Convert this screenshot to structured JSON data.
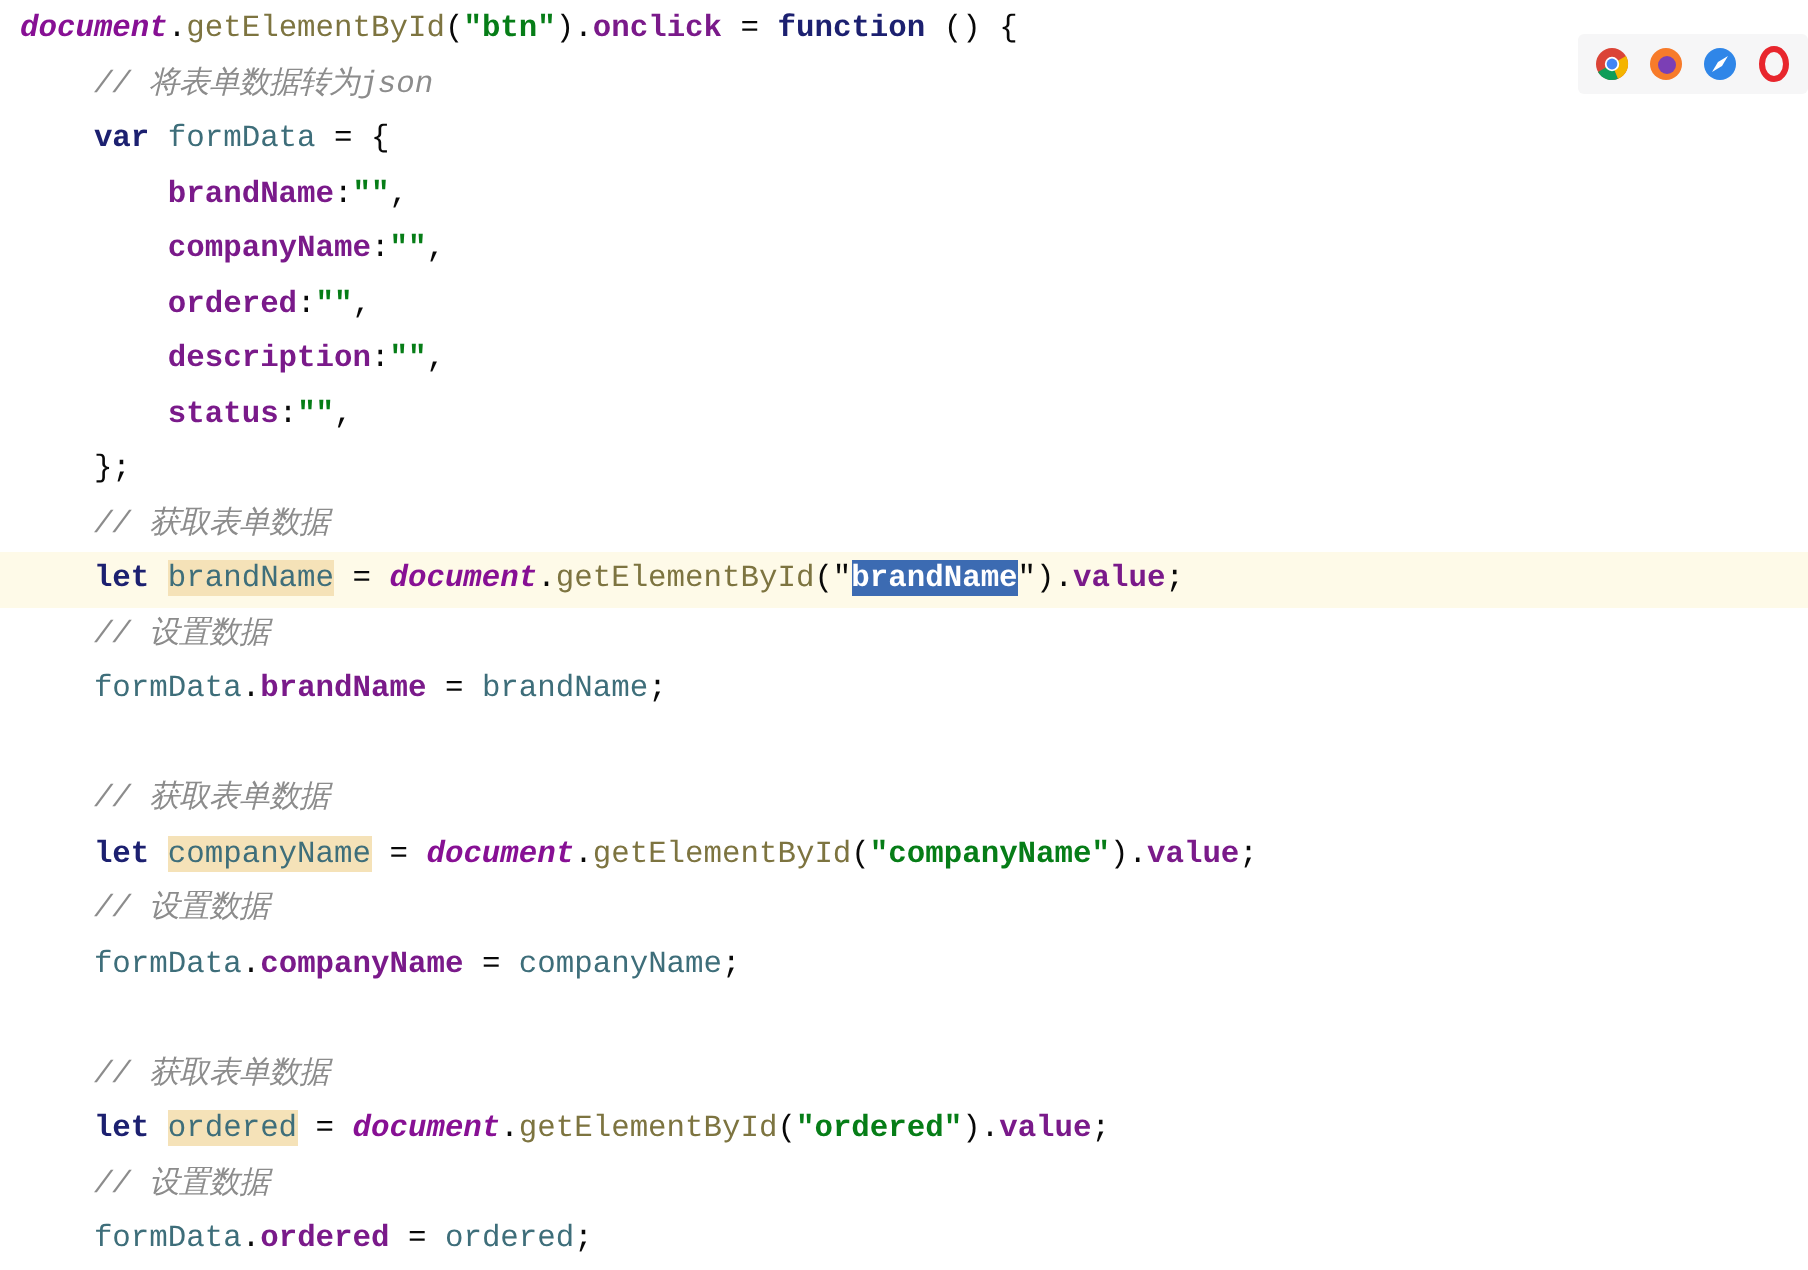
{
  "editor": {
    "lines": [
      {
        "current": false,
        "tokens": [
          {
            "kind": "global",
            "text": "document"
          },
          {
            "kind": "punct",
            "text": "."
          },
          {
            "kind": "method",
            "text": "getElementById"
          },
          {
            "kind": "punct",
            "text": "("
          },
          {
            "kind": "string",
            "text": "\"btn\""
          },
          {
            "kind": "punct",
            "text": ")."
          },
          {
            "kind": "field",
            "text": "onclick"
          },
          {
            "kind": "punct",
            "text": " = "
          },
          {
            "kind": "keyword",
            "text": "function"
          },
          {
            "kind": "punct",
            "text": " () {"
          }
        ]
      },
      {
        "current": false,
        "tokens": [
          {
            "kind": "comment",
            "text": "    // 将表单数据转为json"
          }
        ]
      },
      {
        "current": false,
        "tokens": [
          {
            "kind": "keyword",
            "text": "    var "
          },
          {
            "kind": "var",
            "text": "formData"
          },
          {
            "kind": "punct",
            "text": " = {"
          }
        ]
      },
      {
        "current": false,
        "tokens": [
          {
            "kind": "field",
            "text": "        brandName"
          },
          {
            "kind": "punct",
            "text": ":"
          },
          {
            "kind": "string",
            "text": "\"\""
          },
          {
            "kind": "punct",
            "text": ","
          }
        ]
      },
      {
        "current": false,
        "tokens": [
          {
            "kind": "field",
            "text": "        companyName"
          },
          {
            "kind": "punct",
            "text": ":"
          },
          {
            "kind": "string",
            "text": "\"\""
          },
          {
            "kind": "punct",
            "text": ","
          }
        ]
      },
      {
        "current": false,
        "tokens": [
          {
            "kind": "field",
            "text": "        ordered"
          },
          {
            "kind": "punct",
            "text": ":"
          },
          {
            "kind": "string",
            "text": "\"\""
          },
          {
            "kind": "punct",
            "text": ","
          }
        ]
      },
      {
        "current": false,
        "tokens": [
          {
            "kind": "field",
            "text": "        description"
          },
          {
            "kind": "punct",
            "text": ":"
          },
          {
            "kind": "string",
            "text": "\"\""
          },
          {
            "kind": "punct",
            "text": ","
          }
        ]
      },
      {
        "current": false,
        "tokens": [
          {
            "kind": "field",
            "text": "        status"
          },
          {
            "kind": "punct",
            "text": ":"
          },
          {
            "kind": "string",
            "text": "\"\""
          },
          {
            "kind": "punct",
            "text": ","
          }
        ]
      },
      {
        "current": false,
        "tokens": [
          {
            "kind": "punct",
            "text": "    };"
          }
        ]
      },
      {
        "current": false,
        "tokens": [
          {
            "kind": "comment",
            "text": "    // 获取表单数据"
          }
        ]
      },
      {
        "current": true,
        "tokens": [
          {
            "kind": "keyword",
            "text": "    let "
          },
          {
            "kind": "var",
            "text": "brandName",
            "highlighted": true
          },
          {
            "kind": "punct",
            "text": " = "
          },
          {
            "kind": "global",
            "text": "document"
          },
          {
            "kind": "punct",
            "text": "."
          },
          {
            "kind": "method",
            "text": "getElementById"
          },
          {
            "kind": "punct",
            "text": "(\""
          },
          {
            "kind": "string",
            "text": "brandName",
            "selected": true
          },
          {
            "kind": "punct",
            "text": "\")."
          },
          {
            "kind": "field",
            "text": "value"
          },
          {
            "kind": "punct",
            "text": ";"
          }
        ]
      },
      {
        "current": false,
        "tokens": [
          {
            "kind": "comment",
            "text": "    // 设置数据"
          }
        ]
      },
      {
        "current": false,
        "tokens": [
          {
            "kind": "var",
            "text": "    formData"
          },
          {
            "kind": "punct",
            "text": "."
          },
          {
            "kind": "field",
            "text": "brandName"
          },
          {
            "kind": "punct",
            "text": " = "
          },
          {
            "kind": "var",
            "text": "brandName"
          },
          {
            "kind": "punct",
            "text": ";"
          }
        ]
      },
      {
        "current": false
      },
      {
        "current": false,
        "tokens": [
          {
            "kind": "comment",
            "text": "    // 获取表单数据"
          }
        ]
      },
      {
        "current": false,
        "tokens": [
          {
            "kind": "keyword",
            "text": "    let "
          },
          {
            "kind": "var",
            "text": "companyName",
            "highlighted": true
          },
          {
            "kind": "punct",
            "text": " = "
          },
          {
            "kind": "global",
            "text": "document"
          },
          {
            "kind": "punct",
            "text": "."
          },
          {
            "kind": "method",
            "text": "getElementById"
          },
          {
            "kind": "punct",
            "text": "("
          },
          {
            "kind": "string",
            "text": "\"companyName\""
          },
          {
            "kind": "punct",
            "text": ")."
          },
          {
            "kind": "field",
            "text": "value"
          },
          {
            "kind": "punct",
            "text": ";"
          }
        ]
      },
      {
        "current": false,
        "tokens": [
          {
            "kind": "comment",
            "text": "    // 设置数据"
          }
        ]
      },
      {
        "current": false,
        "tokens": [
          {
            "kind": "var",
            "text": "    formData"
          },
          {
            "kind": "punct",
            "text": "."
          },
          {
            "kind": "field",
            "text": "companyName"
          },
          {
            "kind": "punct",
            "text": " = "
          },
          {
            "kind": "var",
            "text": "companyName"
          },
          {
            "kind": "punct",
            "text": ";"
          }
        ]
      },
      {
        "current": false
      },
      {
        "current": false,
        "tokens": [
          {
            "kind": "comment",
            "text": "    // 获取表单数据"
          }
        ]
      },
      {
        "current": false,
        "tokens": [
          {
            "kind": "keyword",
            "text": "    let "
          },
          {
            "kind": "var",
            "text": "ordered",
            "highlighted": true
          },
          {
            "kind": "punct",
            "text": " = "
          },
          {
            "kind": "global",
            "text": "document"
          },
          {
            "kind": "punct",
            "text": "."
          },
          {
            "kind": "method",
            "text": "getElementById"
          },
          {
            "kind": "punct",
            "text": "("
          },
          {
            "kind": "string",
            "text": "\"ordered\""
          },
          {
            "kind": "punct",
            "text": ")."
          },
          {
            "kind": "field",
            "text": "value"
          },
          {
            "kind": "punct",
            "text": ";"
          }
        ]
      },
      {
        "current": false,
        "tokens": [
          {
            "kind": "comment",
            "text": "    // 设置数据"
          }
        ]
      },
      {
        "current": false,
        "tokens": [
          {
            "kind": "var",
            "text": "    formData"
          },
          {
            "kind": "punct",
            "text": "."
          },
          {
            "kind": "field",
            "text": "ordered"
          },
          {
            "kind": "punct",
            "text": " = "
          },
          {
            "kind": "var",
            "text": "ordered"
          },
          {
            "kind": "punct",
            "text": ";"
          }
        ]
      }
    ]
  }
}
